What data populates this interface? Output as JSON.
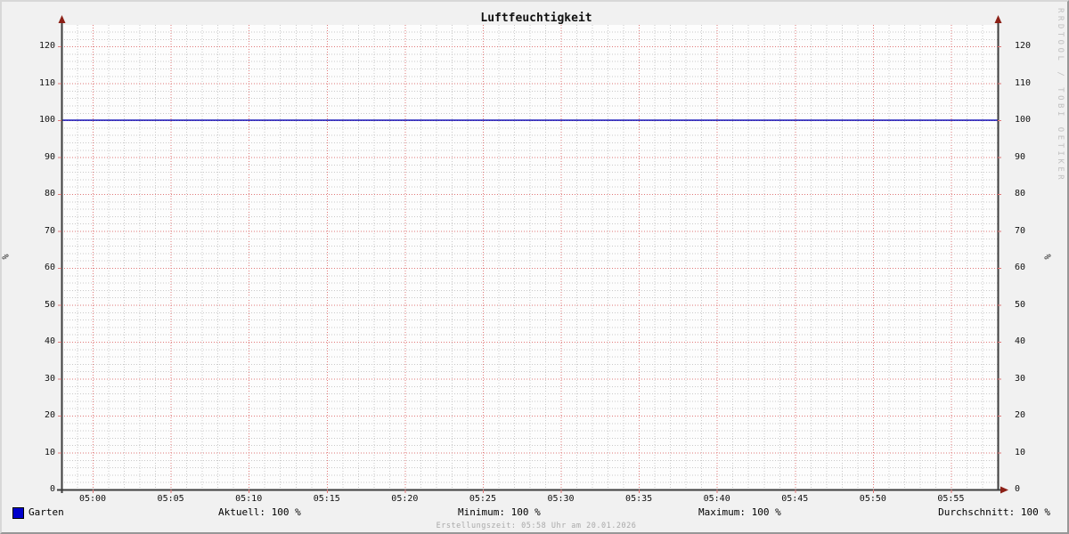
{
  "title": "Luftfeuchtigkeit",
  "watermark": "RRDTOOL / TOBI OETIKER",
  "footer": "Erstellungszeit: 05:58 Uhr am 20.01.2026",
  "legend": {
    "series_label": "Garten",
    "swatch_color": "#0000cc",
    "stats": {
      "aktuell": "Aktuell: 100 %",
      "minimum": "Minimum: 100 %",
      "maximum": "Maximum: 100 %",
      "durchschnitt": "Durchschnitt: 100 %"
    }
  },
  "colors": {
    "background": "#f1f1f1",
    "canvas": "#fdfdfd",
    "axis": "#3d3d3d",
    "arrow": "#8c2016",
    "grid_minor": "#c9c9c9",
    "grid_major": "#e07878",
    "line": "#0000b3",
    "watermark_text": "#c0c0c0",
    "footer_text": "#a9a9a9"
  },
  "chart_data": {
    "type": "line",
    "title": "Luftfeuchtigkeit",
    "xlabel": "",
    "ylabel_left": "%",
    "ylabel_right": "%",
    "x_start": "04:58",
    "x_end": "05:58",
    "x_major_ticks": [
      "05:00",
      "05:05",
      "05:10",
      "05:15",
      "05:20",
      "05:25",
      "05:30",
      "05:35",
      "05:40",
      "05:45",
      "05:50",
      "05:55"
    ],
    "x_minor_step_minutes": 1,
    "ylim": [
      0,
      125.8
    ],
    "y_major_ticks": [
      0,
      10,
      20,
      30,
      40,
      50,
      60,
      70,
      80,
      90,
      100,
      110,
      120
    ],
    "y_minor_step": 2,
    "grid": true,
    "legend_position": "bottom",
    "series": [
      {
        "name": "Garten",
        "color": "#0000b3",
        "x": [
          "04:58",
          "05:58"
        ],
        "values": [
          100,
          100
        ]
      }
    ]
  }
}
